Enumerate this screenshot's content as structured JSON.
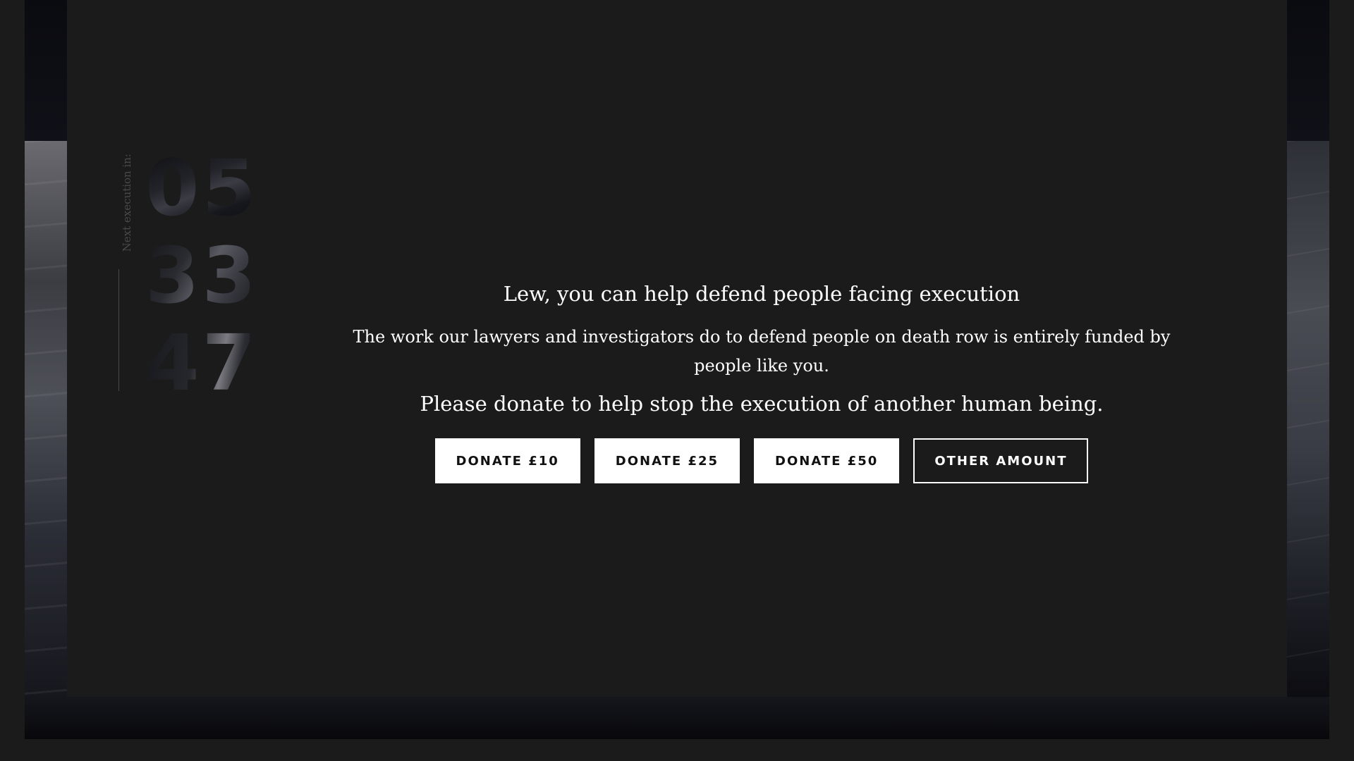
{
  "countdown": {
    "label": "Next execution in:",
    "rows": [
      "05",
      "33",
      "47"
    ]
  },
  "message": {
    "headline": "Lew, you can help defend people facing execution",
    "body": "The work our lawyers and investigators do to defend people on death row is entirely funded by people like you.",
    "appeal": "Please donate to help stop the execution of another human being."
  },
  "donate": {
    "buttons": [
      {
        "label": "DONATE £10"
      },
      {
        "label": "DONATE £25"
      },
      {
        "label": "DONATE £50"
      }
    ],
    "other_label": "OTHER AMOUNT"
  },
  "colors": {
    "overlay_background": "#1b1b1b",
    "button_background": "#ffffff",
    "button_text": "#111111",
    "text": "#ffffff"
  }
}
